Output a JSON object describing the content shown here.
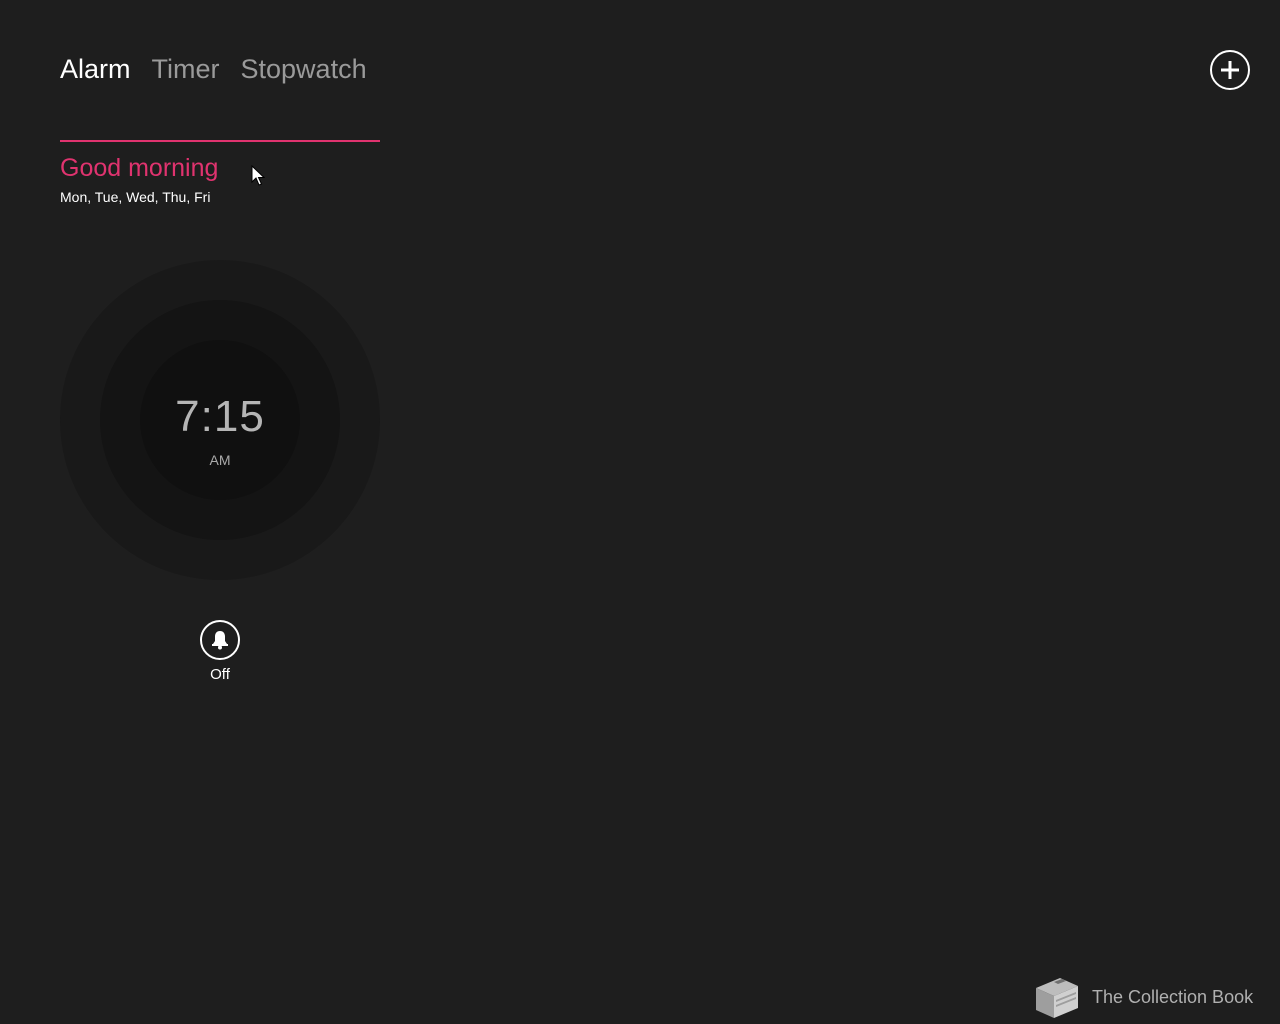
{
  "tabs": [
    {
      "label": "Alarm",
      "active": true
    },
    {
      "label": "Timer",
      "active": false
    },
    {
      "label": "Stopwatch",
      "active": false
    }
  ],
  "header": {
    "add_icon": "plus-circle-icon"
  },
  "alarm": {
    "name": "Good morning",
    "days": "Mon, Tue, Wed, Thu, Fri",
    "time": "7:15",
    "ampm": "AM",
    "toggle_icon": "bell-icon",
    "toggle_label": "Off"
  },
  "watermark": {
    "text": "The Collection Book",
    "icon": "book-icon"
  },
  "colors": {
    "background": "#1e1e1e",
    "accent": "#e0336f"
  }
}
